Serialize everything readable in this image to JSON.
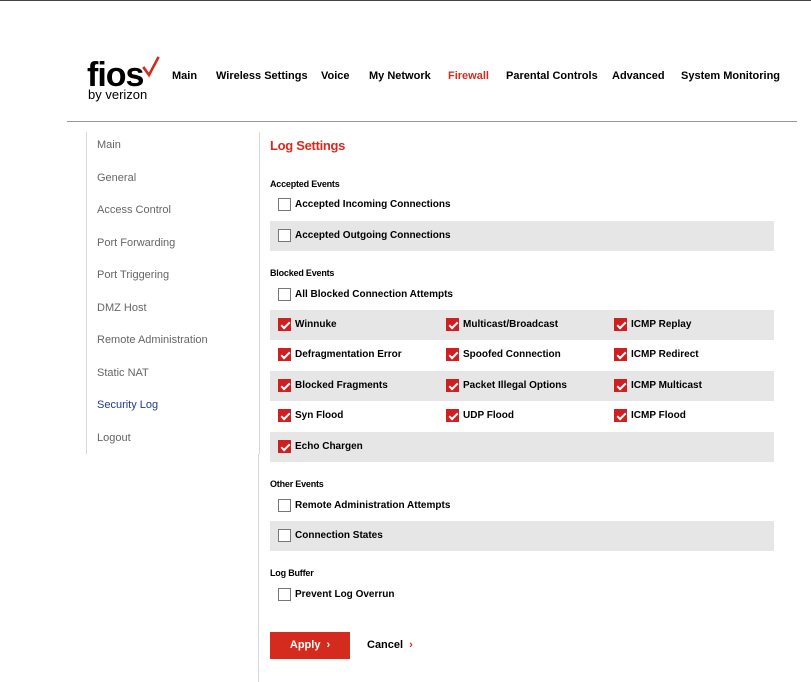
{
  "logo": {
    "word": "fios",
    "sub": "by verizon"
  },
  "nav": [
    {
      "label": "Main"
    },
    {
      "label": "Wireless Settings"
    },
    {
      "label": "Voice"
    },
    {
      "label": "My Network"
    },
    {
      "label": "Firewall",
      "active": true
    },
    {
      "label": "Parental Controls"
    },
    {
      "label": "Advanced"
    },
    {
      "label": "System Monitoring"
    }
  ],
  "sidebar": [
    {
      "label": "Main"
    },
    {
      "label": "General"
    },
    {
      "label": "Access Control"
    },
    {
      "label": "Port Forwarding"
    },
    {
      "label": "Port Triggering"
    },
    {
      "label": "DMZ Host"
    },
    {
      "label": "Remote Administration"
    },
    {
      "label": "Static NAT"
    },
    {
      "label": "Security Log",
      "active": true
    },
    {
      "label": "Logout"
    }
  ],
  "page": {
    "title": "Log Settings"
  },
  "sections": {
    "accepted": {
      "heading": "Accepted Events",
      "incoming": {
        "label": "Accepted Incoming Connections",
        "checked": false
      },
      "outgoing": {
        "label": "Accepted Outgoing Connections",
        "checked": false
      }
    },
    "blocked": {
      "heading": "Blocked Events",
      "all": {
        "label": "All Blocked Connection Attempts",
        "checked": false
      },
      "winnuke": {
        "label": "Winnuke",
        "checked": true
      },
      "multicast_broadcast": {
        "label": "Multicast/Broadcast",
        "checked": true
      },
      "icmp_replay": {
        "label": "ICMP Replay",
        "checked": true
      },
      "defrag_error": {
        "label": "Defragmentation Error",
        "checked": true
      },
      "spoofed": {
        "label": "Spoofed Connection",
        "checked": true
      },
      "icmp_redirect": {
        "label": "ICMP Redirect",
        "checked": true
      },
      "blocked_fragments": {
        "label": "Blocked Fragments",
        "checked": true
      },
      "packet_illegal": {
        "label": "Packet Illegal Options",
        "checked": true
      },
      "icmp_multicast": {
        "label": "ICMP Multicast",
        "checked": true
      },
      "syn_flood": {
        "label": "Syn Flood",
        "checked": true
      },
      "udp_flood": {
        "label": "UDP Flood",
        "checked": true
      },
      "icmp_flood": {
        "label": "ICMP Flood",
        "checked": true
      },
      "echo_chargen": {
        "label": "Echo Chargen",
        "checked": true
      }
    },
    "other": {
      "heading": "Other Events",
      "remote_admin": {
        "label": "Remote Administration Attempts",
        "checked": false
      },
      "conn_states": {
        "label": "Connection States",
        "checked": false
      }
    },
    "buffer": {
      "heading": "Log Buffer",
      "prevent_overrun": {
        "label": "Prevent Log Overrun",
        "checked": false
      }
    }
  },
  "buttons": {
    "apply": "Apply",
    "cancel": "Cancel",
    "arrow": "›"
  },
  "colors": {
    "brand_red": "#d52b1e",
    "active_link": "#1f3a93",
    "row_shade": "#e6e6e6"
  }
}
